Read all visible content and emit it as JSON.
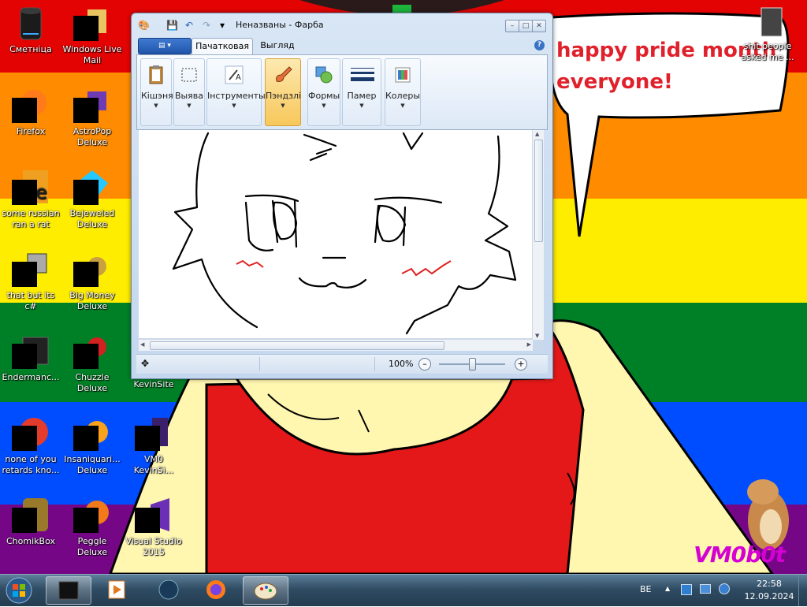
{
  "window": {
    "title": "Неназваны - Фарба",
    "menu_label": "▤ ▾",
    "tabs": [
      {
        "label": "Пачатковая",
        "active": true
      },
      {
        "label": "Выгляд",
        "active": false
      }
    ],
    "ribbon_groups": [
      {
        "label": "Кішэня",
        "icon": "clipboard-icon"
      },
      {
        "label": "Выява",
        "icon": "image-icon"
      },
      {
        "label": "Інструменты",
        "icon": "tools-icon"
      },
      {
        "label": "Пэндзлі",
        "icon": "brush-icon",
        "active": true
      },
      {
        "label": "Формы",
        "icon": "shapes-icon"
      },
      {
        "label": "Памер",
        "icon": "size-icon"
      },
      {
        "label": "Колеры",
        "icon": "colors-icon"
      }
    ],
    "status": {
      "zoom": "100%"
    }
  },
  "desktop": {
    "speech_text": [
      "happy pride month",
      "everyone!"
    ],
    "signature": "VM0b0t",
    "icons": [
      {
        "label": "Сметніца"
      },
      {
        "label": "Windows Live Mail"
      },
      {
        "label": "Firefox"
      },
      {
        "label": "AstroPop Deluxe"
      },
      {
        "label": "some russian ran a rat"
      },
      {
        "label": "Bejeweled Deluxe"
      },
      {
        "label": "that but its c#"
      },
      {
        "label": "Big Money Deluxe"
      },
      {
        "label": "Endermanc..."
      },
      {
        "label": "Chuzzle Deluxe"
      },
      {
        "label": "VM0bot KevinSite"
      },
      {
        "label": "none of you retards kno..."
      },
      {
        "label": "Insaniquari... Deluxe"
      },
      {
        "label": "VM0 KevinSi..."
      },
      {
        "label": "ChomikBox"
      },
      {
        "label": "Peggle Deluxe"
      },
      {
        "label": "Visual Studio 2015"
      },
      {
        "label": "shit people asked me ..."
      }
    ]
  },
  "taskbar": {
    "language": "BE",
    "time": "22:58",
    "date": "12.09.2024"
  },
  "colors": {
    "rainbow": [
      "#e40303",
      "#ff8c00",
      "#ffed00",
      "#008026",
      "#004dff",
      "#750787"
    ],
    "accent": "#f7c75a"
  }
}
